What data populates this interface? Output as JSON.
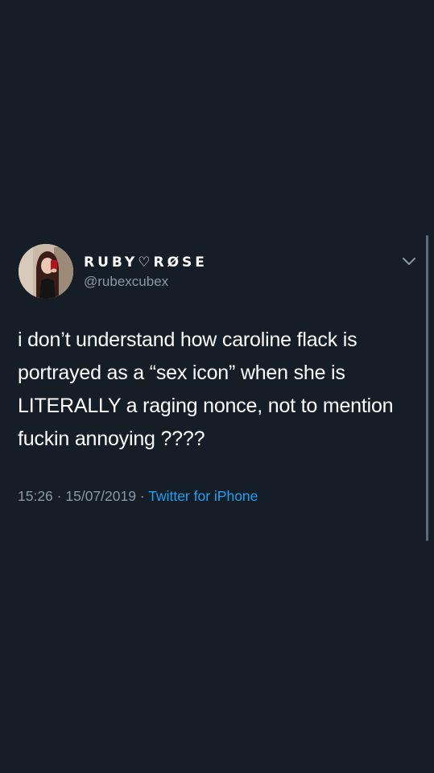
{
  "tweet": {
    "display_name": "RUBY♡RØSE",
    "handle": "@rubexcubex",
    "text": "i don’t understand how caroline flack is portrayed as a “sex icon” when she is LITERALLY a raging nonce, not to mention fuckin annoying ????",
    "time": "15:26",
    "separator": "·",
    "date": "15/07/2019",
    "source": "Twitter for iPhone"
  },
  "icons": {
    "avatar": "profile-photo",
    "menu": "chevron-down-icon"
  },
  "colors": {
    "background": "#151d27",
    "text": "#ffffff",
    "secondary_text": "#8899a6",
    "link": "#1da1f2"
  }
}
